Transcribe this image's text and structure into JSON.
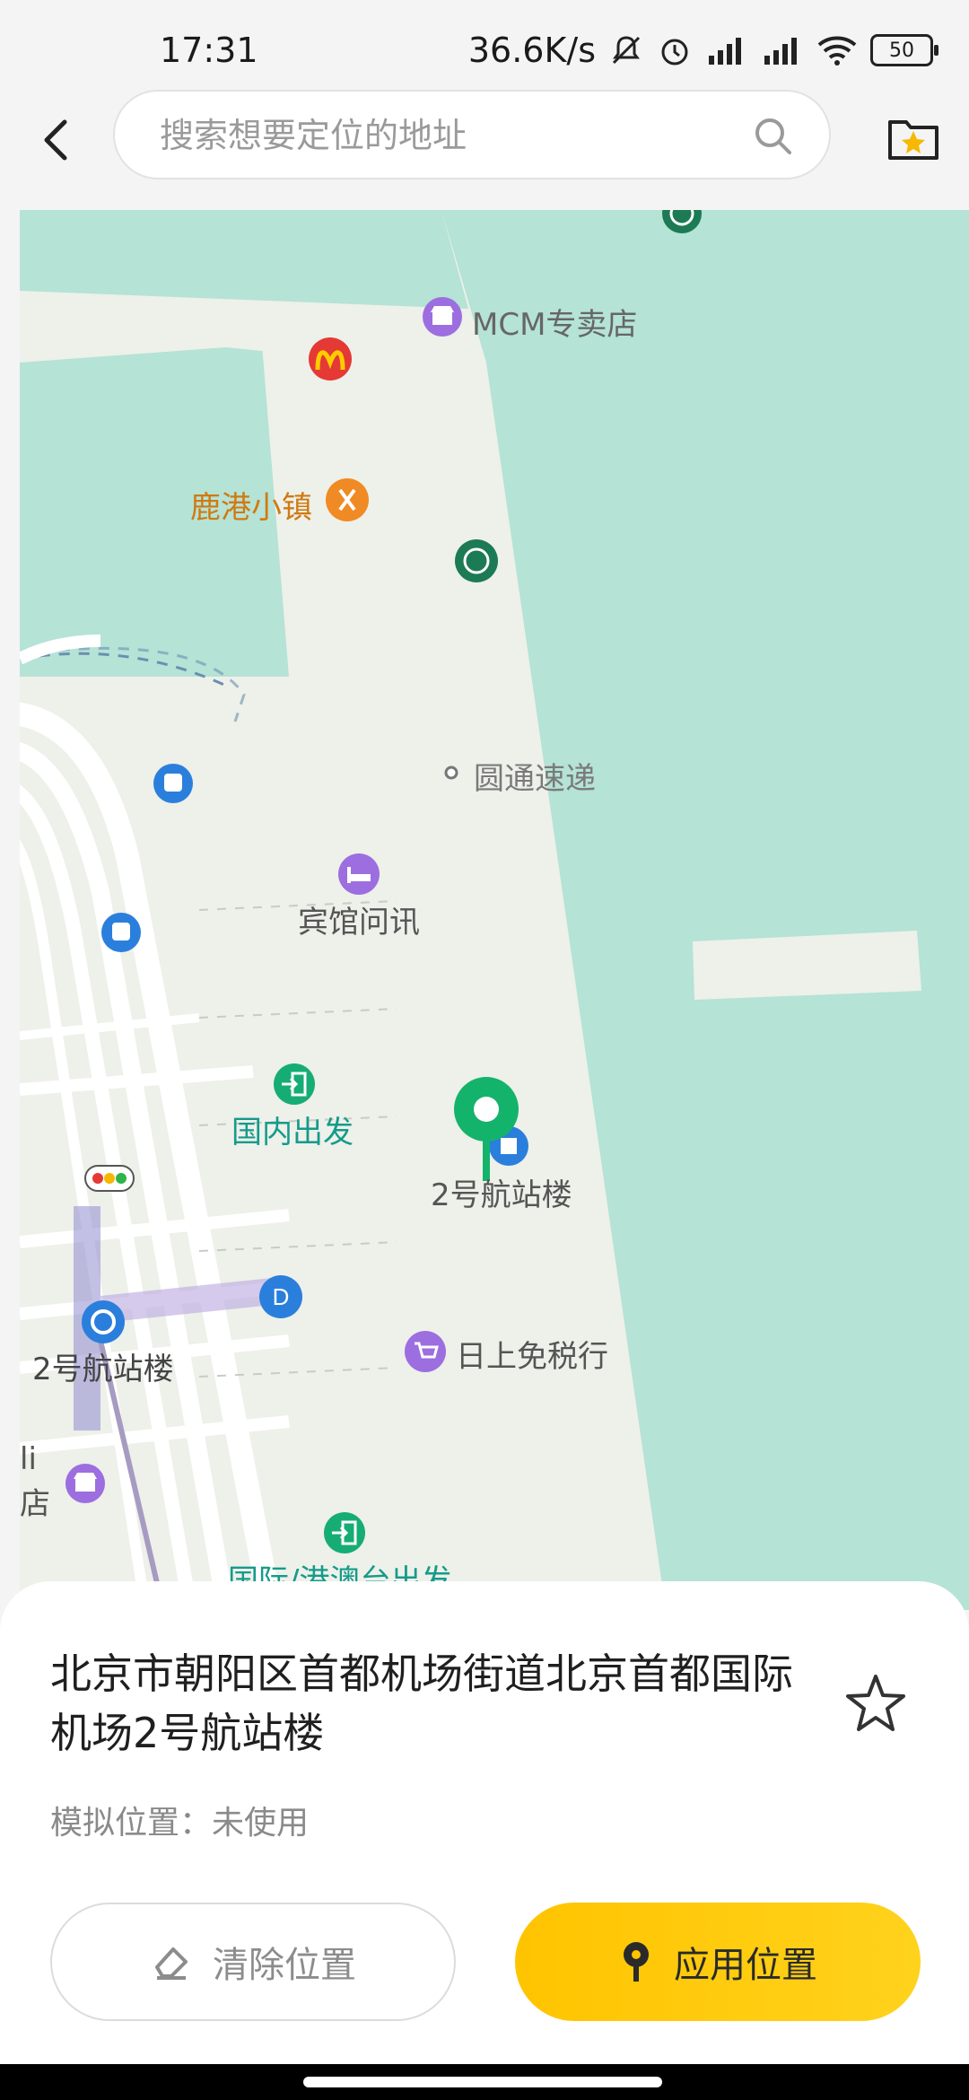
{
  "status_bar": {
    "time": "17:31",
    "net_speed": "36.6K/s",
    "battery": "50"
  },
  "search": {
    "placeholder": "搜索想要定位的地址"
  },
  "map": {
    "pois": {
      "mcm": "MCM专卖店",
      "lugang": "鹿港小镇",
      "yuantong": "圆通速递",
      "hotel": "宾馆问讯",
      "domestic": "国内出发",
      "t2": "2号航站楼",
      "duty_free": "日上免税行",
      "t2_station": "2号航站楼",
      "intl": "国际/港澳台出发",
      "edge_li": "li",
      "edge_store": "店"
    },
    "colors": {
      "water": "#b5e3d6",
      "land": "#eef0ea",
      "road": "#ffffff",
      "pin": "#14b36b"
    }
  },
  "sheet": {
    "address": "北京市朝阳区首都机场街道北京首都国际机场2号航站楼",
    "mock_status": "模拟位置：未使用",
    "clear_label": "清除位置",
    "apply_label": "应用位置"
  }
}
